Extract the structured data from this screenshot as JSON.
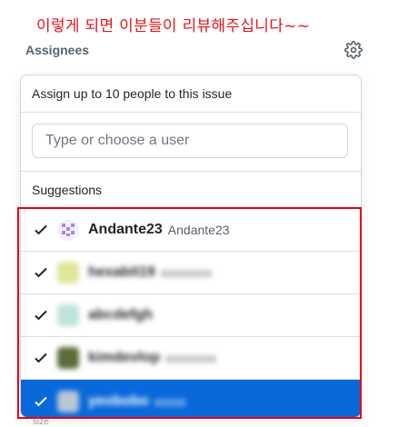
{
  "annotation": "이렇게 되면 이분들이  리뷰해주십니다~~",
  "assignees": {
    "title": "Assignees",
    "settings_icon": "gear-icon"
  },
  "popover": {
    "header": "Assign up to 10 people to this issue",
    "filter_placeholder": "Type or choose a user",
    "section_title": "Suggestions"
  },
  "users": [
    {
      "login": "Andante23",
      "name": "Andante23",
      "checked": true,
      "selected": false
    },
    {
      "login": "hexabit19",
      "name": "xxxxxxxx",
      "checked": true,
      "selected": false
    },
    {
      "login": "abcdefgh",
      "name": "",
      "checked": true,
      "selected": false
    },
    {
      "login": "kimdevlop",
      "name": "xxxxxxxx",
      "checked": true,
      "selected": false
    },
    {
      "login": "yeobobo",
      "name": "xxxxx",
      "checked": true,
      "selected": true
    }
  ],
  "colors": {
    "accent": "#0969da",
    "highlight": "#e60012",
    "annotation": "#e4161b"
  },
  "bottom_peek": "size"
}
